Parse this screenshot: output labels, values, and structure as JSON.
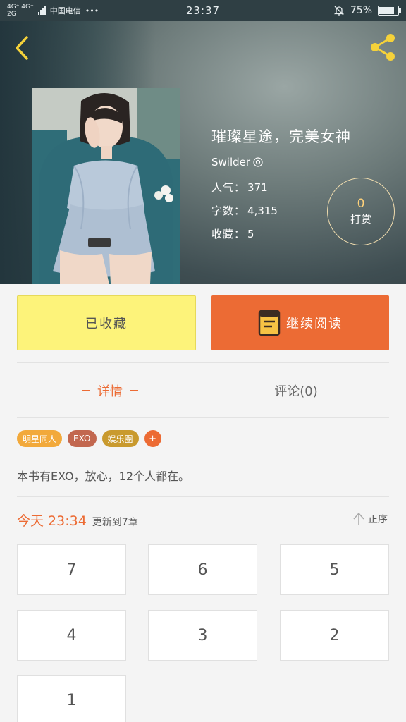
{
  "status_bar": {
    "network_top": "4G⁺ 4G⁺",
    "network_bottom": "2G",
    "carrier": "中国电信",
    "more": "•••",
    "time": "23:37",
    "battery": "75%",
    "battery_level": 0.75
  },
  "book": {
    "title": "璀璨星途，完美女神",
    "author": "Swilder",
    "stats": [
      {
        "label": "人气",
        "value": "371"
      },
      {
        "label": "字数",
        "value": "4,315"
      },
      {
        "label": "收藏",
        "value": "5"
      }
    ],
    "reward": {
      "count": "0",
      "label": "打赏"
    }
  },
  "actions": {
    "collected_label": "已收藏",
    "read_label": "继续阅读"
  },
  "tabs": {
    "detail": "详情",
    "comment": "评论(0)"
  },
  "tags": [
    {
      "label": "明星同人",
      "color": "#f2a93b"
    },
    {
      "label": "EXO",
      "color": "#c2674f"
    },
    {
      "label": "娱乐圈",
      "color": "#c99a2e"
    }
  ],
  "tag_add": "+",
  "description": "本书有EXO，放心，12个人都在。",
  "update": {
    "time": "今天 23:34",
    "text": "更新到7章"
  },
  "sort_label": "正序",
  "chapters": [
    "7",
    "6",
    "5",
    "4",
    "3",
    "2",
    "1"
  ],
  "colors": {
    "accent": "#ec6b34",
    "collected_bg": "#fdf37a"
  }
}
